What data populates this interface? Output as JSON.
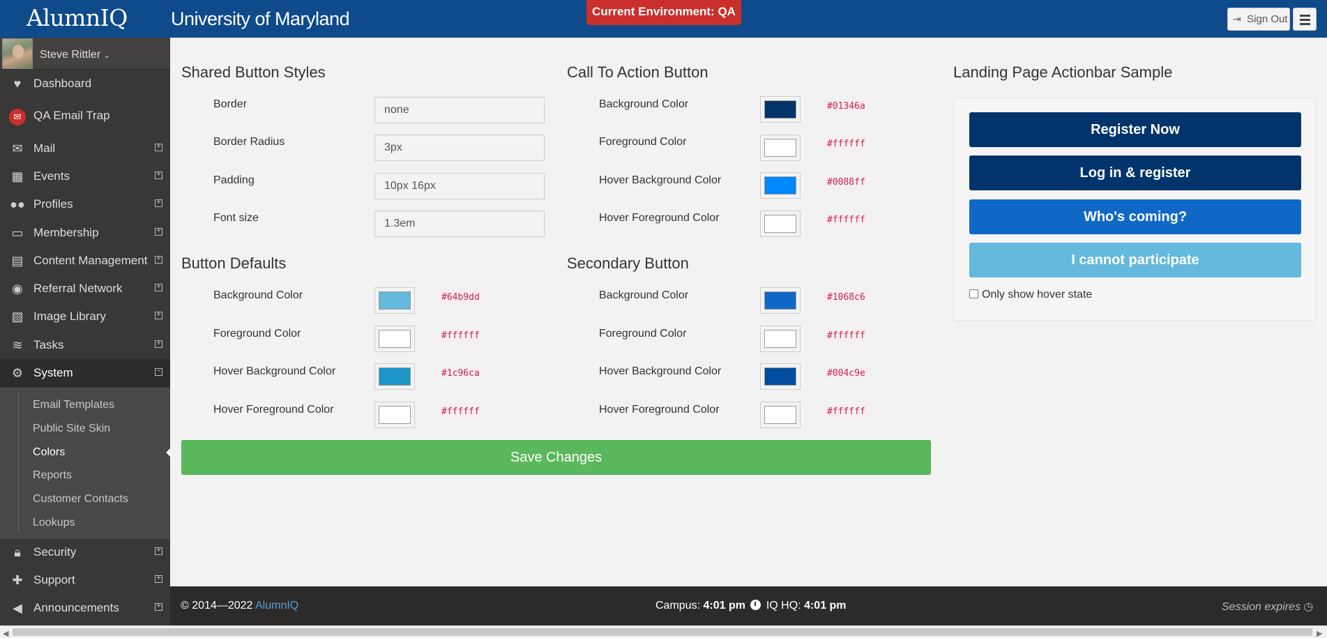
{
  "header": {
    "logo": "AlumnIQ",
    "school": "University of Maryland",
    "environment": "Current Environment: QA",
    "sign_out": "Sign Out",
    "sign_out_icon": "sign-out-icon",
    "menu_icon": "hamburger-icon"
  },
  "sidebar": {
    "user": "Steve Rittler",
    "items": [
      {
        "label": "Dashboard",
        "icon": "heartbeat-icon"
      },
      {
        "label": "QA Email Trap",
        "icon": "email-trap-icon"
      },
      {
        "label": "Mail",
        "icon": "envelope-icon"
      },
      {
        "label": "Events",
        "icon": "calendar-icon"
      },
      {
        "label": "Profiles",
        "icon": "users-icon"
      },
      {
        "label": "Membership",
        "icon": "id-card-icon"
      },
      {
        "label": "Content Management",
        "icon": "newspaper-icon"
      },
      {
        "label": "Referral Network",
        "icon": "podcast-icon"
      },
      {
        "label": "Image Library",
        "icon": "image-icon"
      },
      {
        "label": "Tasks",
        "icon": "database-icon"
      },
      {
        "label": "System",
        "icon": "cogs-icon"
      },
      {
        "label": "Security",
        "icon": "lock-icon"
      },
      {
        "label": "Support",
        "icon": "ambulance-icon"
      },
      {
        "label": "Announcements",
        "icon": "bullhorn-icon"
      }
    ],
    "system_sub": [
      "Email Templates",
      "Public Site Skin",
      "Colors",
      "Reports",
      "Customer Contacts",
      "Lookups"
    ]
  },
  "shared": {
    "title": "Shared Button Styles",
    "rows": [
      {
        "label": "Border",
        "value": "none"
      },
      {
        "label": "Border Radius",
        "value": "3px"
      },
      {
        "label": "Padding",
        "value": "10px 16px"
      },
      {
        "label": "Font size",
        "value": "1.3em"
      }
    ]
  },
  "cta": {
    "title": "Call To Action Button",
    "rows": [
      {
        "label": "Background Color",
        "hex": "#01346a"
      },
      {
        "label": "Foreground Color",
        "hex": "#ffffff"
      },
      {
        "label": "Hover Background Color",
        "hex": "#0088ff"
      },
      {
        "label": "Hover Foreground Color",
        "hex": "#ffffff"
      }
    ]
  },
  "defaults": {
    "title": "Button Defaults",
    "rows": [
      {
        "label": "Background Color",
        "hex": "#64b9dd"
      },
      {
        "label": "Foreground Color",
        "hex": "#ffffff"
      },
      {
        "label": "Hover Background Color",
        "hex": "#1c96ca"
      },
      {
        "label": "Hover Foreground Color",
        "hex": "#ffffff"
      }
    ]
  },
  "secondary": {
    "title": "Secondary Button",
    "rows": [
      {
        "label": "Background Color",
        "hex": "#1068c6"
      },
      {
        "label": "Foreground Color",
        "hex": "#ffffff"
      },
      {
        "label": "Hover Background Color",
        "hex": "#004c9e"
      },
      {
        "label": "Hover Foreground Color",
        "hex": "#ffffff"
      }
    ]
  },
  "save": "Save Changes",
  "sample": {
    "title": "Landing Page Actionbar Sample",
    "buttons": [
      {
        "label": "Register Now",
        "bg": "#01346a"
      },
      {
        "label": "Log in & register",
        "bg": "#01346a"
      },
      {
        "label": "Who's coming?",
        "bg": "#1068c6"
      },
      {
        "label": "I cannot participate",
        "bg": "#64b9dd"
      }
    ],
    "checkbox": "Only show hover state"
  },
  "footer": {
    "copy": "© 2014—2022 ",
    "brand": "AlumnIQ",
    "campus_label": "Campus: ",
    "campus_time": "4:01 pm",
    "hq_label": " IQ HQ: ",
    "hq_time": "4:01 pm",
    "session": "Session expires",
    "clock_icon": "clock-icon"
  }
}
